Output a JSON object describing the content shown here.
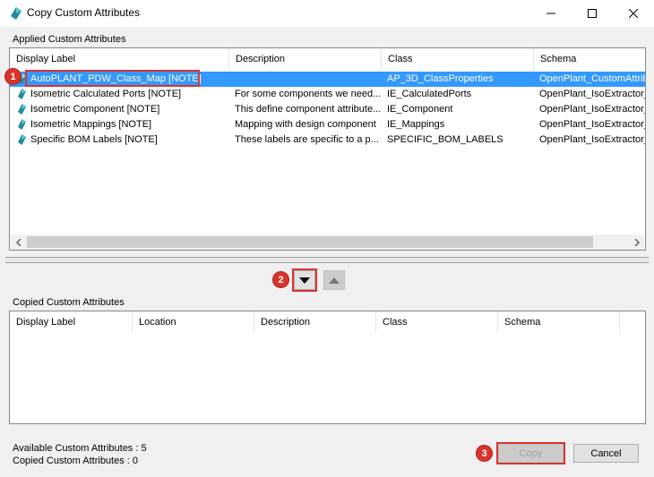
{
  "window": {
    "title": "Copy Custom Attributes",
    "minimize_icon": "minimize-icon",
    "maximize_icon": "maximize-icon",
    "close_icon": "close-icon"
  },
  "applied": {
    "group_label": "Applied Custom Attributes",
    "columns": [
      "Display Label",
      "Description",
      "Class",
      "Schema"
    ],
    "rows": [
      {
        "label": "AutoPLANT_PDW_Class_Map [NOTE]",
        "description": "",
        "class": "AP_3D_ClassProperties",
        "schema": "OpenPlant_CustomAttribu"
      },
      {
        "label": "Isometric Calculated Ports [NOTE]",
        "description": "For some components we need...",
        "class": "IE_CalculatedPorts",
        "schema": "OpenPlant_IsoExtractor_"
      },
      {
        "label": "Isometric Component [NOTE]",
        "description": "This define component attribute...",
        "class": "IE_Component",
        "schema": "OpenPlant_IsoExtractor_"
      },
      {
        "label": "Isometric Mappings [NOTE]",
        "description": "Mapping with design component",
        "class": "IE_Mappings",
        "schema": "OpenPlant_IsoExtractor_"
      },
      {
        "label": "Specific BOM Labels [NOTE]",
        "description": "These labels are specific to a p...",
        "class": "SPECIFIC_BOM_LABELS",
        "schema": "OpenPlant_IsoExtractor_"
      }
    ]
  },
  "copied": {
    "group_label": "Copied Custom Attributes",
    "columns": [
      "Display Label",
      "Location",
      "Description",
      "Class",
      "Schema"
    ]
  },
  "status": {
    "available": "Available Custom Attributes : 5",
    "copied": "Copied Custom Attributes : 0"
  },
  "buttons": {
    "copy": "Copy",
    "cancel": "Cancel",
    "move_down_icon": "arrow-down-icon",
    "move_up_icon": "arrow-up-icon"
  },
  "callouts": [
    "1",
    "2",
    "3"
  ],
  "colors": {
    "selection": "#3399ff",
    "callout": "#d9342b"
  }
}
